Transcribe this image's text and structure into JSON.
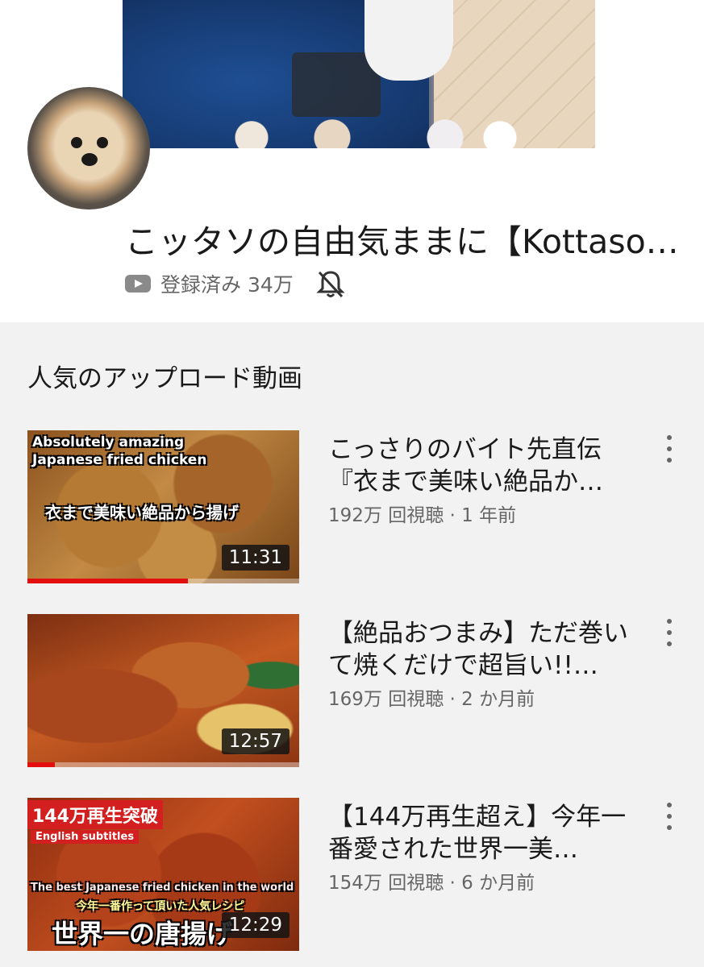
{
  "channel": {
    "title": "こッタソの自由気ままに【Kottaso…",
    "subscribe_status": "登録済み 34万",
    "icons": {
      "subscribed": "youtube-play-icon",
      "notifications": "bell-off-icon"
    }
  },
  "section": {
    "title": "人気のアップロード動画"
  },
  "videos": [
    {
      "title": "こっさりのバイト先直伝『衣まで美味い絶品か…",
      "meta": "192万 回視聴 · 1 年前",
      "duration": "11:31",
      "watched_fraction": 0.59,
      "thumb_text": {
        "line1": "Absolutely amazing",
        "line2": "Japanese fried chicken",
        "line3": "衣まで美味い絶品から揚げ"
      }
    },
    {
      "title": "【絶品おつまみ】ただ巻いて焼くだけで超旨い!!…",
      "meta": "169万 回視聴 · 2 か月前",
      "duration": "12:57",
      "watched_fraction": 0.1
    },
    {
      "title": "【144万再生超え】今年一番愛された世界一美…",
      "meta": "154万 回視聴 · 6 か月前",
      "duration": "12:29",
      "watched_fraction": 0,
      "thumb_text": {
        "banner": "144万再生突破",
        "subs": "English subtitles",
        "en": "The best Japanese fried chicken in the world",
        "jp_small": "今年一番作って頂いた人気レシピ",
        "jp_big": "世界一の唐揚げ"
      }
    }
  ],
  "colors": {
    "accent_red": "#e30e0e",
    "secondary_text": "#666666",
    "background": "#f2f2f2"
  }
}
